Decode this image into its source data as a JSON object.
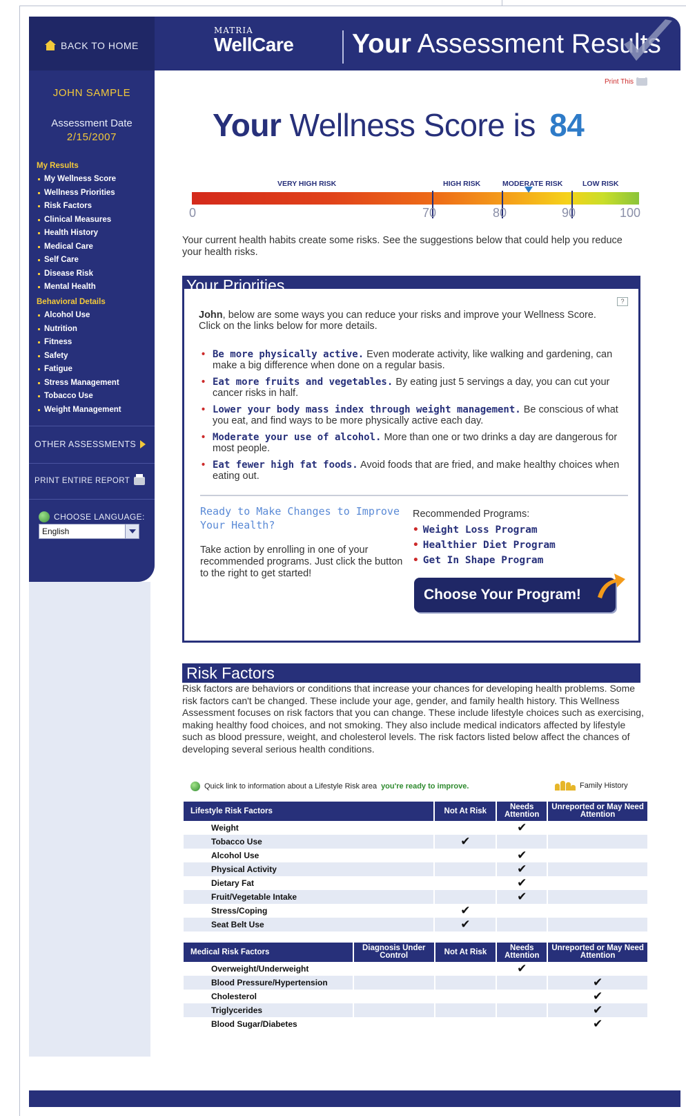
{
  "header": {
    "back_home": "BACK TO HOME",
    "logo_top": "MATRIA",
    "logo_main": "WellCare",
    "title_bold": "Your",
    "title_rest": "Assessment Results"
  },
  "sidebar": {
    "user_name": "JOHN SAMPLE",
    "assessment_label": "Assessment Date",
    "assessment_date": "2/15/2007",
    "my_results_heading": "My Results",
    "my_results": [
      "My Wellness Score",
      "Wellness Priorities",
      "Risk Factors",
      "Clinical Measures",
      "Health History",
      "Medical Care",
      "Self Care",
      "Disease Risk",
      "Mental Health"
    ],
    "behavioral_heading": "Behavioral Details",
    "behavioral": [
      "Alcohol Use",
      "Nutrition",
      "Fitness",
      "Safety",
      "Fatigue",
      "Stress Management",
      "Tobacco Use",
      "Weight Management"
    ],
    "other_assessments": "OTHER ASSESSMENTS",
    "print_report": "PRINT ENTIRE REPORT",
    "choose_language": "CHOOSE LANGUAGE:",
    "language_value": "English"
  },
  "score": {
    "print_this": "Print This",
    "title_bold": "Your",
    "title_rest": "Wellness Score is",
    "value": "84",
    "bands": [
      "VERY HIGH RISK",
      "HIGH RISK",
      "MODERATE RISK",
      "LOW RISK"
    ],
    "scale_numbers": [
      "0",
      "70",
      "80",
      "90",
      "100"
    ],
    "marker_value": 84,
    "intro": "Your current health habits create some risks. See the suggestions below that could help you reduce your health risks."
  },
  "priorities": {
    "heading": "Your Priorities",
    "help": "?",
    "intro_name": "John",
    "intro_rest": ", below are some ways you can reduce your risks and improve your Wellness Score. Click on the links below for more details.",
    "items": [
      {
        "bold": "Be more physically active.",
        "text": " Even moderate activity, like walking and gardening, can make a big difference when done on a regular basis."
      },
      {
        "bold": "Eat more fruits and vegetables.",
        "text": " By eating just 5 servings a day, you can cut your cancer risks in half."
      },
      {
        "bold": "Lower your body mass index through weight management.",
        "text": " Be conscious of what you eat, and find ways to be more physically active each day."
      },
      {
        "bold": "Moderate your use of alcohol.",
        "text": " More than one or two drinks a day are dangerous for most people."
      },
      {
        "bold": "Eat fewer high fat foods.",
        "text": " Avoid foods that are fried, and make healthy choices when eating out."
      }
    ],
    "ready_title": "Ready to Make Changes to Improve Your Health?",
    "ready_body": "Take action by enrolling in one of your recommended programs. Just click the button to the right to get started!",
    "rec_title": "Recommended Programs:",
    "programs": [
      "Weight Loss Program",
      "Healthier Diet Program",
      "Get In Shape Program"
    ],
    "choose_button": "Choose Your Program!"
  },
  "risk": {
    "heading": "Risk Factors",
    "text": "Risk factors are behaviors or conditions that increase your chances for developing health problems. Some risk factors can't be changed. These include your age, gender, and family health history. This Wellness Assessment focuses on risk factors that you can change. These include lifestyle choices such as exercising, making healthy food choices, and not smoking. They also include medical indicators affected by lifestyle such as blood pressure, weight, and cholesterol levels. The risk factors listed below affect the chances of developing several serious health conditions.",
    "quick_link_prefix": "Quick link to information about a Lifestyle Risk area",
    "quick_link_green": "you're ready to improve.",
    "family_history": "Family History",
    "lifestyle_headers": [
      "Lifestyle Risk Factors",
      "Not At Risk",
      "Needs Attention",
      "Unreported or May Need Attention"
    ],
    "lifestyle_rows": [
      {
        "name": "Weight",
        "c": [
          "",
          "✔",
          ""
        ]
      },
      {
        "name": "Tobacco Use",
        "c": [
          "✔",
          "",
          ""
        ]
      },
      {
        "name": "Alcohol Use",
        "c": [
          "",
          "✔",
          ""
        ]
      },
      {
        "name": "Physical Activity",
        "c": [
          "",
          "✔",
          ""
        ]
      },
      {
        "name": "Dietary Fat",
        "c": [
          "",
          "✔",
          ""
        ]
      },
      {
        "name": "Fruit/Vegetable Intake",
        "c": [
          "",
          "✔",
          ""
        ]
      },
      {
        "name": "Stress/Coping",
        "c": [
          "✔",
          "",
          ""
        ]
      },
      {
        "name": "Seat Belt Use",
        "c": [
          "✔",
          "",
          ""
        ]
      }
    ],
    "medical_headers": [
      "Medical Risk Factors",
      "Diagnosis Under Control",
      "Not At Risk",
      "Needs Attention",
      "Unreported or May Need Attention"
    ],
    "medical_rows": [
      {
        "name": "Overweight/Underweight",
        "c": [
          "",
          "",
          "✔",
          ""
        ]
      },
      {
        "name": "Blood Pressure/Hypertension",
        "c": [
          "",
          "",
          "",
          "✔"
        ]
      },
      {
        "name": "Cholesterol",
        "c": [
          "",
          "",
          "",
          "✔"
        ]
      },
      {
        "name": "Triglycerides",
        "c": [
          "",
          "",
          "",
          "✔"
        ]
      },
      {
        "name": "Blood Sugar/Diabetes",
        "c": [
          "",
          "",
          "",
          "✔"
        ]
      }
    ]
  },
  "colors": {
    "navy": "#27307a",
    "accent_yellow": "#f3c93a",
    "score_blue": "#2e7bc8",
    "bullet_red": "#cc2a2a"
  }
}
